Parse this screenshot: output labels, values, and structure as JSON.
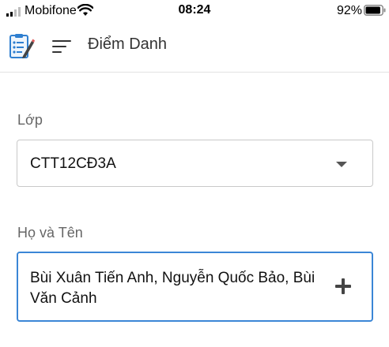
{
  "status_bar": {
    "carrier": "Mobifone",
    "time": "08:24",
    "battery_percent": "92%",
    "battery_level": 0.92,
    "signal_icon": "signal-icon",
    "wifi_icon": "wifi-icon",
    "battery_icon": "battery-icon"
  },
  "app_bar": {
    "logo_icon": "checklist-icon",
    "menu_icon": "menu-icon",
    "title": "Điểm Danh"
  },
  "form": {
    "class_field": {
      "label": "Lớp",
      "value": "CTT12CĐ3A",
      "dropdown_icon": "chevron-down-icon"
    },
    "name_field": {
      "label": "Họ và Tên",
      "value": "Bùi Xuân Tiến Anh, Nguyễn Quốc Bảo, Bùi Văn Cảnh",
      "add_icon": "plus-icon"
    }
  },
  "colors": {
    "focus_border": "#3b86d6",
    "logo_blue": "#2f7fd0"
  }
}
